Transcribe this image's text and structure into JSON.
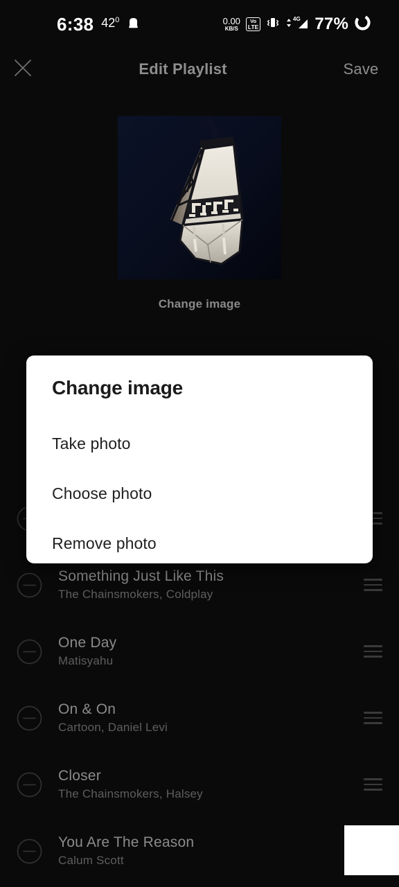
{
  "status_bar": {
    "time": "6:38",
    "temperature": "42",
    "degree_symbol": "0",
    "weather_icon": "cloud-icon",
    "network_speed_value": "0.00",
    "network_speed_unit": "KB/S",
    "volte_top": "VoLTE",
    "volte_line1": "Vo",
    "volte_line2": "LTE",
    "vibrate_icon": "vibrate-icon",
    "data_arrows_icon": "data-transfer-icon",
    "network_type": "4G",
    "signal_icon": "signal-bars-icon",
    "battery_percent": "77%",
    "battery_icon": "battery-circle-icon"
  },
  "header": {
    "close_icon": "close-icon",
    "title": "Edit Playlist",
    "save_label": "Save"
  },
  "cover": {
    "alt": "hanging-lantern-photo",
    "change_image_label": "Change image"
  },
  "dialog": {
    "title": "Change image",
    "options": [
      {
        "label": "Take photo",
        "name": "take-photo"
      },
      {
        "label": "Choose photo",
        "name": "choose-photo"
      },
      {
        "label": "Remove photo",
        "name": "remove-photo"
      }
    ]
  },
  "songs": [
    {
      "title": "Something Just Like This",
      "artist": "The Chainsmokers, Coldplay"
    },
    {
      "title": "One Day",
      "artist": "Matisyahu"
    },
    {
      "title": "On & On",
      "artist": "Cartoon, Daniel Levi"
    },
    {
      "title": "Closer",
      "artist": "The Chainsmokers, Halsey"
    },
    {
      "title": "You Are The Reason",
      "artist": "Calum Scott"
    }
  ],
  "colors": {
    "background": "#0a0a0a",
    "dialog_background": "#ffffff",
    "primary_text": "#8b8b8b",
    "secondary_text": "#5e5e5e",
    "header_text": "#8e8e8e",
    "dialog_text": "#1f1f1f"
  }
}
